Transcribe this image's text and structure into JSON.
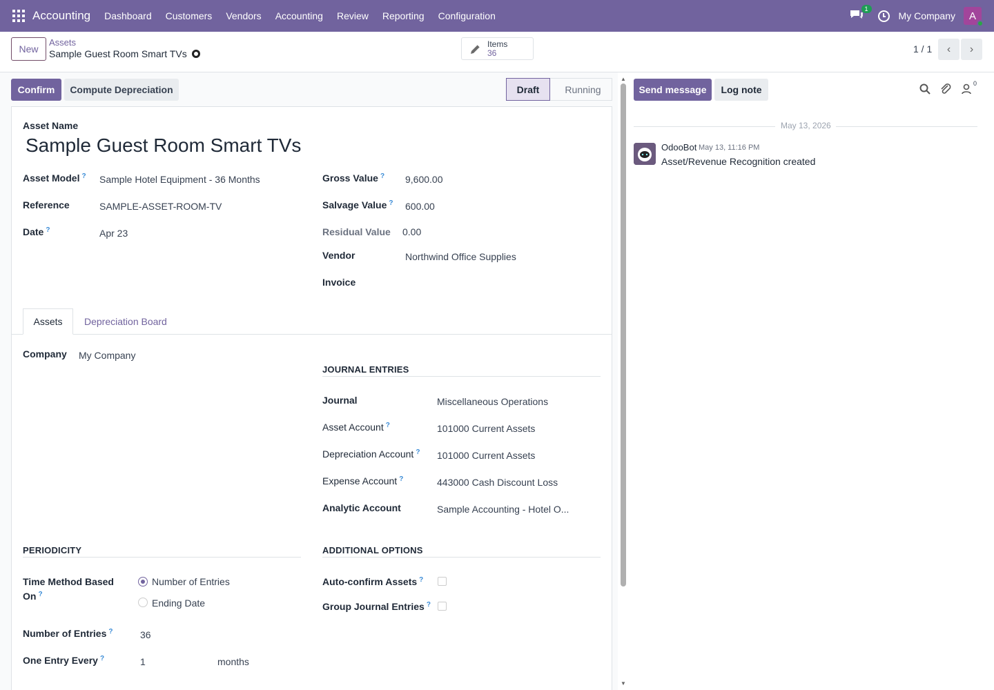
{
  "navbar": {
    "app_name": "Accounting",
    "menu": [
      "Dashboard",
      "Customers",
      "Vendors",
      "Accounting",
      "Review",
      "Reporting",
      "Configuration"
    ],
    "chat_badge": "1",
    "company": "My Company",
    "avatar_letter": "A",
    "theme_color": "#71639e"
  },
  "control": {
    "new_label": "New",
    "breadcrumb_parent": "Assets",
    "breadcrumb_current": "Sample Guest Room Smart TVs",
    "items_label": "Items",
    "items_count": "36",
    "pager": "1 / 1"
  },
  "form": {
    "confirm_label": "Confirm",
    "compute_label": "Compute Depreciation",
    "status": [
      "Draft",
      "Running"
    ],
    "asset_name_label": "Asset Name",
    "asset_name": "Sample Guest Room Smart TVs",
    "left_fields": [
      {
        "label": "Asset Model",
        "help": "?",
        "value": "Sample Hotel Equipment - 36 Months"
      },
      {
        "label": "Reference",
        "value": "SAMPLE-ASSET-ROOM-TV"
      },
      {
        "label": "Date",
        "help": "?",
        "value": "Apr 23"
      }
    ],
    "right_fields": [
      {
        "label": "Gross Value",
        "help": "?",
        "value": "9,600.00"
      },
      {
        "label": "Salvage Value",
        "help": "?",
        "value": "600.00"
      },
      {
        "label": "Residual Value",
        "value": "0.00"
      },
      {
        "label": "Vendor",
        "value": "Northwind Office Supplies"
      },
      {
        "label": "Invoice",
        "value": ""
      }
    ],
    "tabs": [
      "Assets",
      "Depreciation Board"
    ],
    "company_label": "Company",
    "company_value": "My Company",
    "journal_section": "JOURNAL ENTRIES",
    "journal_fields": [
      {
        "label": "Journal",
        "value": "Miscellaneous Operations"
      },
      {
        "label": "Asset Account",
        "help": "?",
        "value": "101000 Current Assets"
      },
      {
        "label": "Depreciation Account",
        "help": "?",
        "value": "101000 Current Assets"
      },
      {
        "label": "Expense Account",
        "help": "?",
        "value": "443000 Cash Discount Loss"
      },
      {
        "label": "Analytic Account",
        "value": "Sample Accounting - Hotel O..."
      }
    ],
    "periodicity_section": "PERIODICITY",
    "time_method_label_1": "Time Method Based",
    "time_method_label_2": "On",
    "time_method_options": [
      "Number of Entries",
      "Ending Date"
    ],
    "time_method_selected": "Number of Entries",
    "entries_label": "Number of Entries",
    "entries_value": "36",
    "every_label": "One Entry Every",
    "every_value": "1",
    "every_unit": "months",
    "additional_section": "ADDITIONAL OPTIONS",
    "auto_confirm_label": "Auto-confirm Assets",
    "group_entries_label": "Group Journal Entries",
    "help": "?"
  },
  "chatter": {
    "send_label": "Send message",
    "log_label": "Log note",
    "followers_count": "0",
    "date": "May 13, 2026",
    "author": "OdooBot",
    "time": "May 13, 11:16 PM",
    "body": "Asset/Revenue Recognition created"
  }
}
